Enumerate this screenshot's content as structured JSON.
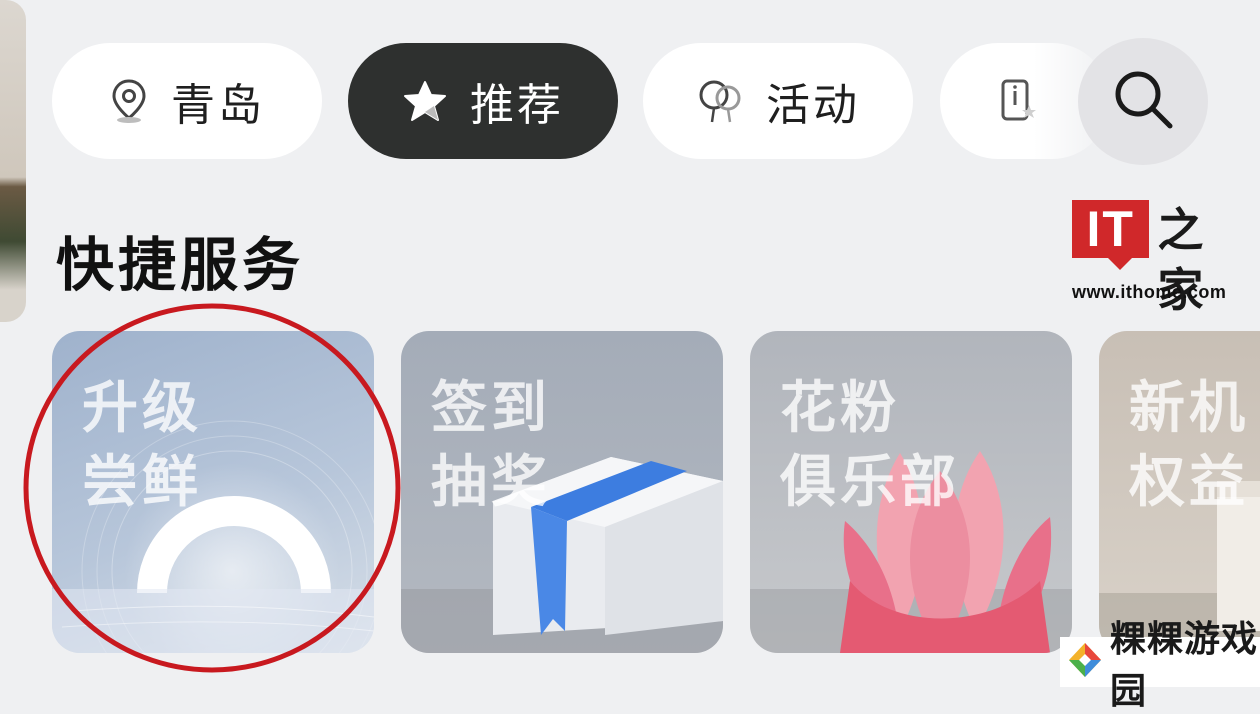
{
  "chips": [
    {
      "label": "青岛",
      "icon": "location-pin-icon",
      "active": false
    },
    {
      "label": "推荐",
      "icon": "star-icon",
      "active": true
    },
    {
      "label": "活动",
      "icon": "balloon-icon",
      "active": false
    },
    {
      "label": "",
      "icon": "phone-star-icon",
      "active": false
    }
  ],
  "search": {
    "icon": "search-icon"
  },
  "section": {
    "title": "快捷服务"
  },
  "cards": [
    {
      "line1": "升级",
      "line2": "尝鲜",
      "highlighted": true
    },
    {
      "line1": "签到",
      "line2": "抽奖"
    },
    {
      "line1": "花粉",
      "line2": "俱乐部"
    },
    {
      "line1": "新机",
      "line2": "权益"
    }
  ],
  "watermark": {
    "logo_it": "IT",
    "logo_zh": "之家",
    "url": "www.ithome.com"
  },
  "site_badge": {
    "name": "粿粿游戏园"
  },
  "colors": {
    "background": "#eff0f2",
    "active_chip": "#2e302f",
    "highlight_circle": "#c8191f",
    "it_red": "#d0282a"
  }
}
